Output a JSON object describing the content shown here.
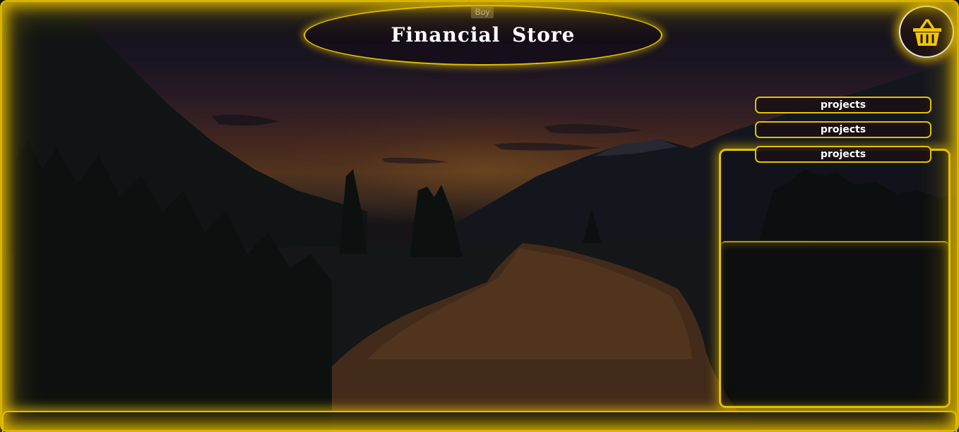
{
  "header": {
    "buy_label": "Buy",
    "title": "Financial Store"
  },
  "cart": {
    "icon": "basket-icon",
    "icon_color": "#f2c700"
  },
  "nav": {
    "items": [
      {
        "label": "projects"
      },
      {
        "label": "projects"
      },
      {
        "label": "projects"
      }
    ]
  },
  "theme": {
    "accent": "#e2c200",
    "background_scene": "river valley at sunset"
  }
}
